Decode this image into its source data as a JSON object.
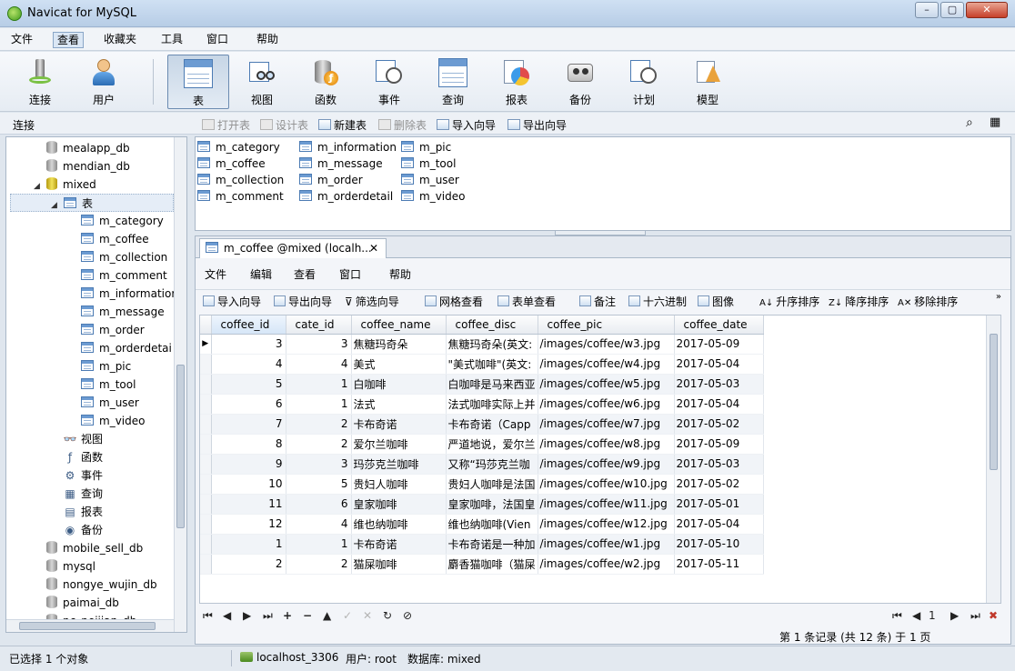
{
  "window": {
    "title": "Navicat for MySQL",
    "min": "–",
    "max": "▢",
    "close": "✕"
  },
  "menu": [
    "文件",
    "查看",
    "收藏夹",
    "工具",
    "窗口",
    "帮助"
  ],
  "toolbar": [
    "连接",
    "用户",
    "表",
    "视图",
    "函数",
    "事件",
    "查询",
    "报表",
    "备份",
    "计划",
    "模型"
  ],
  "subtoolbar": {
    "label": "连接",
    "buttons": [
      "打开表",
      "设计表",
      "新建表",
      "删除表",
      "导入向导",
      "导出向导"
    ]
  },
  "tree": {
    "databases_top": [
      "mealapp_db",
      "mendian_db"
    ],
    "open_db": "mixed",
    "tables_node": "表",
    "tables": [
      "m_category",
      "m_coffee",
      "m_collection",
      "m_comment",
      "m_informatior",
      "m_message",
      "m_order",
      "m_orderdetai",
      "m_pic",
      "m_tool",
      "m_user",
      "m_video"
    ],
    "objects": [
      "视图",
      "函数",
      "事件",
      "查询",
      "报表",
      "备份"
    ],
    "object_icons": [
      "👓",
      "ƒ",
      "⚙",
      "▦",
      "▤",
      "◉"
    ],
    "databases_bottom": [
      "mobile_sell_db",
      "mysql",
      "nongye_wujin_db",
      "paimai_db",
      "pc_peijian_db"
    ]
  },
  "object_list": [
    "m_category",
    "m_coffee",
    "m_collection",
    "m_comment",
    "m_information",
    "m_message",
    "m_order",
    "m_orderdetail",
    "m_pic",
    "m_tool",
    "m_user",
    "m_video"
  ],
  "editor": {
    "tab_title": "m_coffee @mixed (localh...",
    "tab_close": "✕",
    "menu": [
      "文件",
      "编辑",
      "查看",
      "窗口",
      "帮助"
    ],
    "toolbar": [
      "导入向导",
      "导出向导",
      "筛选向导",
      "网格查看",
      "表单查看",
      "备注",
      "十六进制",
      "图像",
      "升序排序",
      "降序排序",
      "移除排序"
    ],
    "more": "»"
  },
  "grid": {
    "columns": [
      "coffee_id",
      "cate_id",
      "coffee_name",
      "coffee_disc",
      "coffee_pic",
      "coffee_date"
    ],
    "current_row_marker": "▶",
    "rows": [
      [
        "3",
        "3",
        "焦糖玛奇朵",
        "焦糖玛奇朵(英文:",
        "/images/coffee/w3.jpg",
        "2017-05-09"
      ],
      [
        "4",
        "4",
        "美式",
        "\"美式咖啡\"(英文:",
        "/images/coffee/w4.jpg",
        "2017-05-04"
      ],
      [
        "5",
        "1",
        "白咖啡",
        "白咖啡是马来西亚",
        "/images/coffee/w5.jpg",
        "2017-05-03"
      ],
      [
        "6",
        "1",
        "法式",
        "法式咖啡实际上并",
        "/images/coffee/w6.jpg",
        "2017-05-04"
      ],
      [
        "7",
        "2",
        "卡布奇诺",
        "卡布奇诺（Capp",
        "/images/coffee/w7.jpg",
        "2017-05-02"
      ],
      [
        "8",
        "2",
        "爱尔兰咖啡",
        "严道地说，爱尔兰",
        "/images/coffee/w8.jpg",
        "2017-05-09"
      ],
      [
        "9",
        "3",
        "玛莎克兰咖啡",
        "又称“玛莎克兰咖",
        "/images/coffee/w9.jpg",
        "2017-05-03"
      ],
      [
        "10",
        "5",
        "贵妇人咖啡",
        "贵妇人咖啡是法国",
        "/images/coffee/w10.jpg",
        "2017-05-02"
      ],
      [
        "11",
        "6",
        "皇家咖啡",
        "皇家咖啡，法国皇",
        "/images/coffee/w11.jpg",
        "2017-05-01"
      ],
      [
        "12",
        "4",
        "维也纳咖啡",
        "维也纳咖啡(Vien",
        "/images/coffee/w12.jpg",
        "2017-05-04"
      ],
      [
        "1",
        "1",
        "卡布奇诺",
        "卡布奇诺是一种加",
        "/images/coffee/w1.jpg",
        "2017-05-10"
      ],
      [
        "2",
        "2",
        "猫屎咖啡",
        "麝香猫咖啡（猫屎",
        "/images/coffee/w2.jpg",
        "2017-05-11"
      ]
    ]
  },
  "navigator": {
    "left": [
      "⏮",
      "◀",
      "▶",
      "⏭",
      "+",
      "−",
      "▲",
      "✓",
      "✕",
      "↻",
      "⊘"
    ],
    "right": [
      "⏮",
      "◀",
      "1",
      "▶",
      "⏭",
      "✖"
    ],
    "record_info": "第 1 条记录 (共 12 条) 于 1 页"
  },
  "status": {
    "selection": "已选择 1 个对象",
    "connection": "localhost_3306",
    "user": "用户: root",
    "database": "数据库: mixed"
  },
  "colors": {
    "accent": "#4c7bb3",
    "selected_bg": "#e5edf7"
  }
}
